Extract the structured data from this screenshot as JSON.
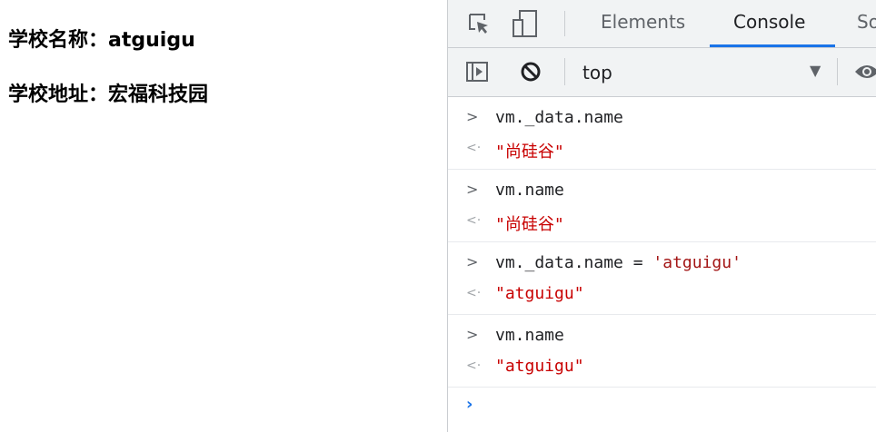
{
  "page": {
    "school_name_label": "学校名称：",
    "school_name_value": "atguigu",
    "school_address_label": "学校地址：",
    "school_address_value": "宏福科技园"
  },
  "devtools": {
    "tabs": [
      {
        "label": "Elements",
        "active": false
      },
      {
        "label": "Console",
        "active": true
      },
      {
        "label": "So",
        "active": false
      }
    ],
    "context": "top",
    "accent_color": "#1a73e8"
  },
  "console": {
    "entries": [
      {
        "input": "vm._data.name",
        "output": "\"尚硅谷\""
      },
      {
        "input": "vm.name",
        "output": "\"尚硅谷\""
      },
      {
        "input_prefix": "vm._data.name",
        "input_op": " = ",
        "input_value": "'atguigu'",
        "output": "\"atguigu\""
      },
      {
        "input": "vm.name",
        "output": "\"atguigu\""
      }
    ],
    "prompt_symbol": "›"
  }
}
